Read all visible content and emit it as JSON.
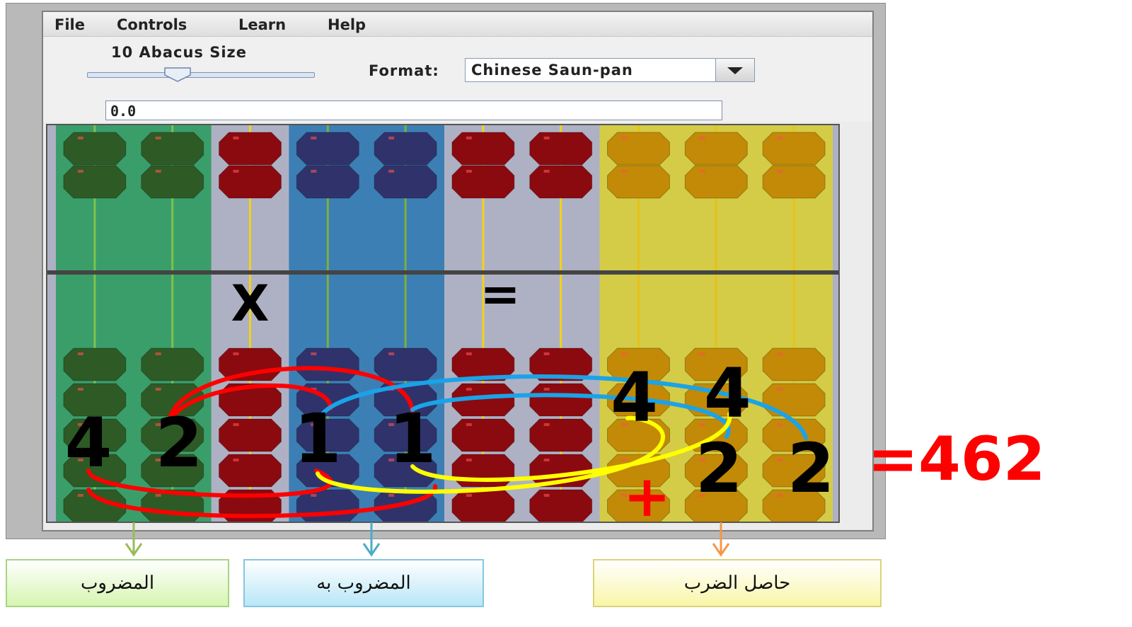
{
  "menu": {
    "items": [
      "File",
      "Controls",
      "Learn",
      "Help"
    ]
  },
  "toolbar": {
    "size_label": "10  Abacus Size",
    "size_value": 10,
    "slider_fraction": 0.4,
    "format_label": "Format:",
    "format_value": "Chinese Saun-pan",
    "value_field": "0.0"
  },
  "abacus": {
    "rods": 10,
    "groups": [
      {
        "name": "multiplicand",
        "rods": [
          0,
          1
        ],
        "bead_color": "#2e5a26",
        "band_color": "#3a9e6a",
        "rod_color": "#7fc24a"
      },
      {
        "name": "operator-x",
        "rods": [
          2
        ],
        "bead_color": "#8b0a0f",
        "band_color": null,
        "rod_color": "#f3d21a"
      },
      {
        "name": "multiplier",
        "rods": [
          3,
          4
        ],
        "bead_color": "#30336b",
        "band_color": "#3c7fb5",
        "rod_color": "#7fae3a"
      },
      {
        "name": "operator-eq",
        "rods": [
          5,
          6
        ],
        "bead_color": "#8b0a0f",
        "band_color": null,
        "rod_color": "#f3d21a"
      },
      {
        "name": "product",
        "rods": [
          7,
          8,
          9
        ],
        "bead_color": "#c28a06",
        "band_color": "#d4cc46",
        "rod_color": "#e6c21a"
      }
    ],
    "operator_x": "X",
    "operator_eq": "=",
    "plus_sign": "+",
    "digits": {
      "multiplicand": [
        "4",
        "2"
      ],
      "multiplier": [
        "1",
        "1"
      ],
      "product_partials": [
        "4",
        "4",
        "2",
        "2"
      ]
    }
  },
  "result": "=462",
  "labels": {
    "multiplicand": "المضروب",
    "multiplier": "المضروب به",
    "product": "حاصل الضرب"
  },
  "colors": {
    "result": "#ff0000",
    "arrow_green": "#9bbb59",
    "arrow_blue": "#4bacc6",
    "arrow_orange": "#f79646",
    "curve_red": "#ff0000",
    "curve_blue": "#1aa3e8",
    "curve_yellow": "#ffff00"
  }
}
